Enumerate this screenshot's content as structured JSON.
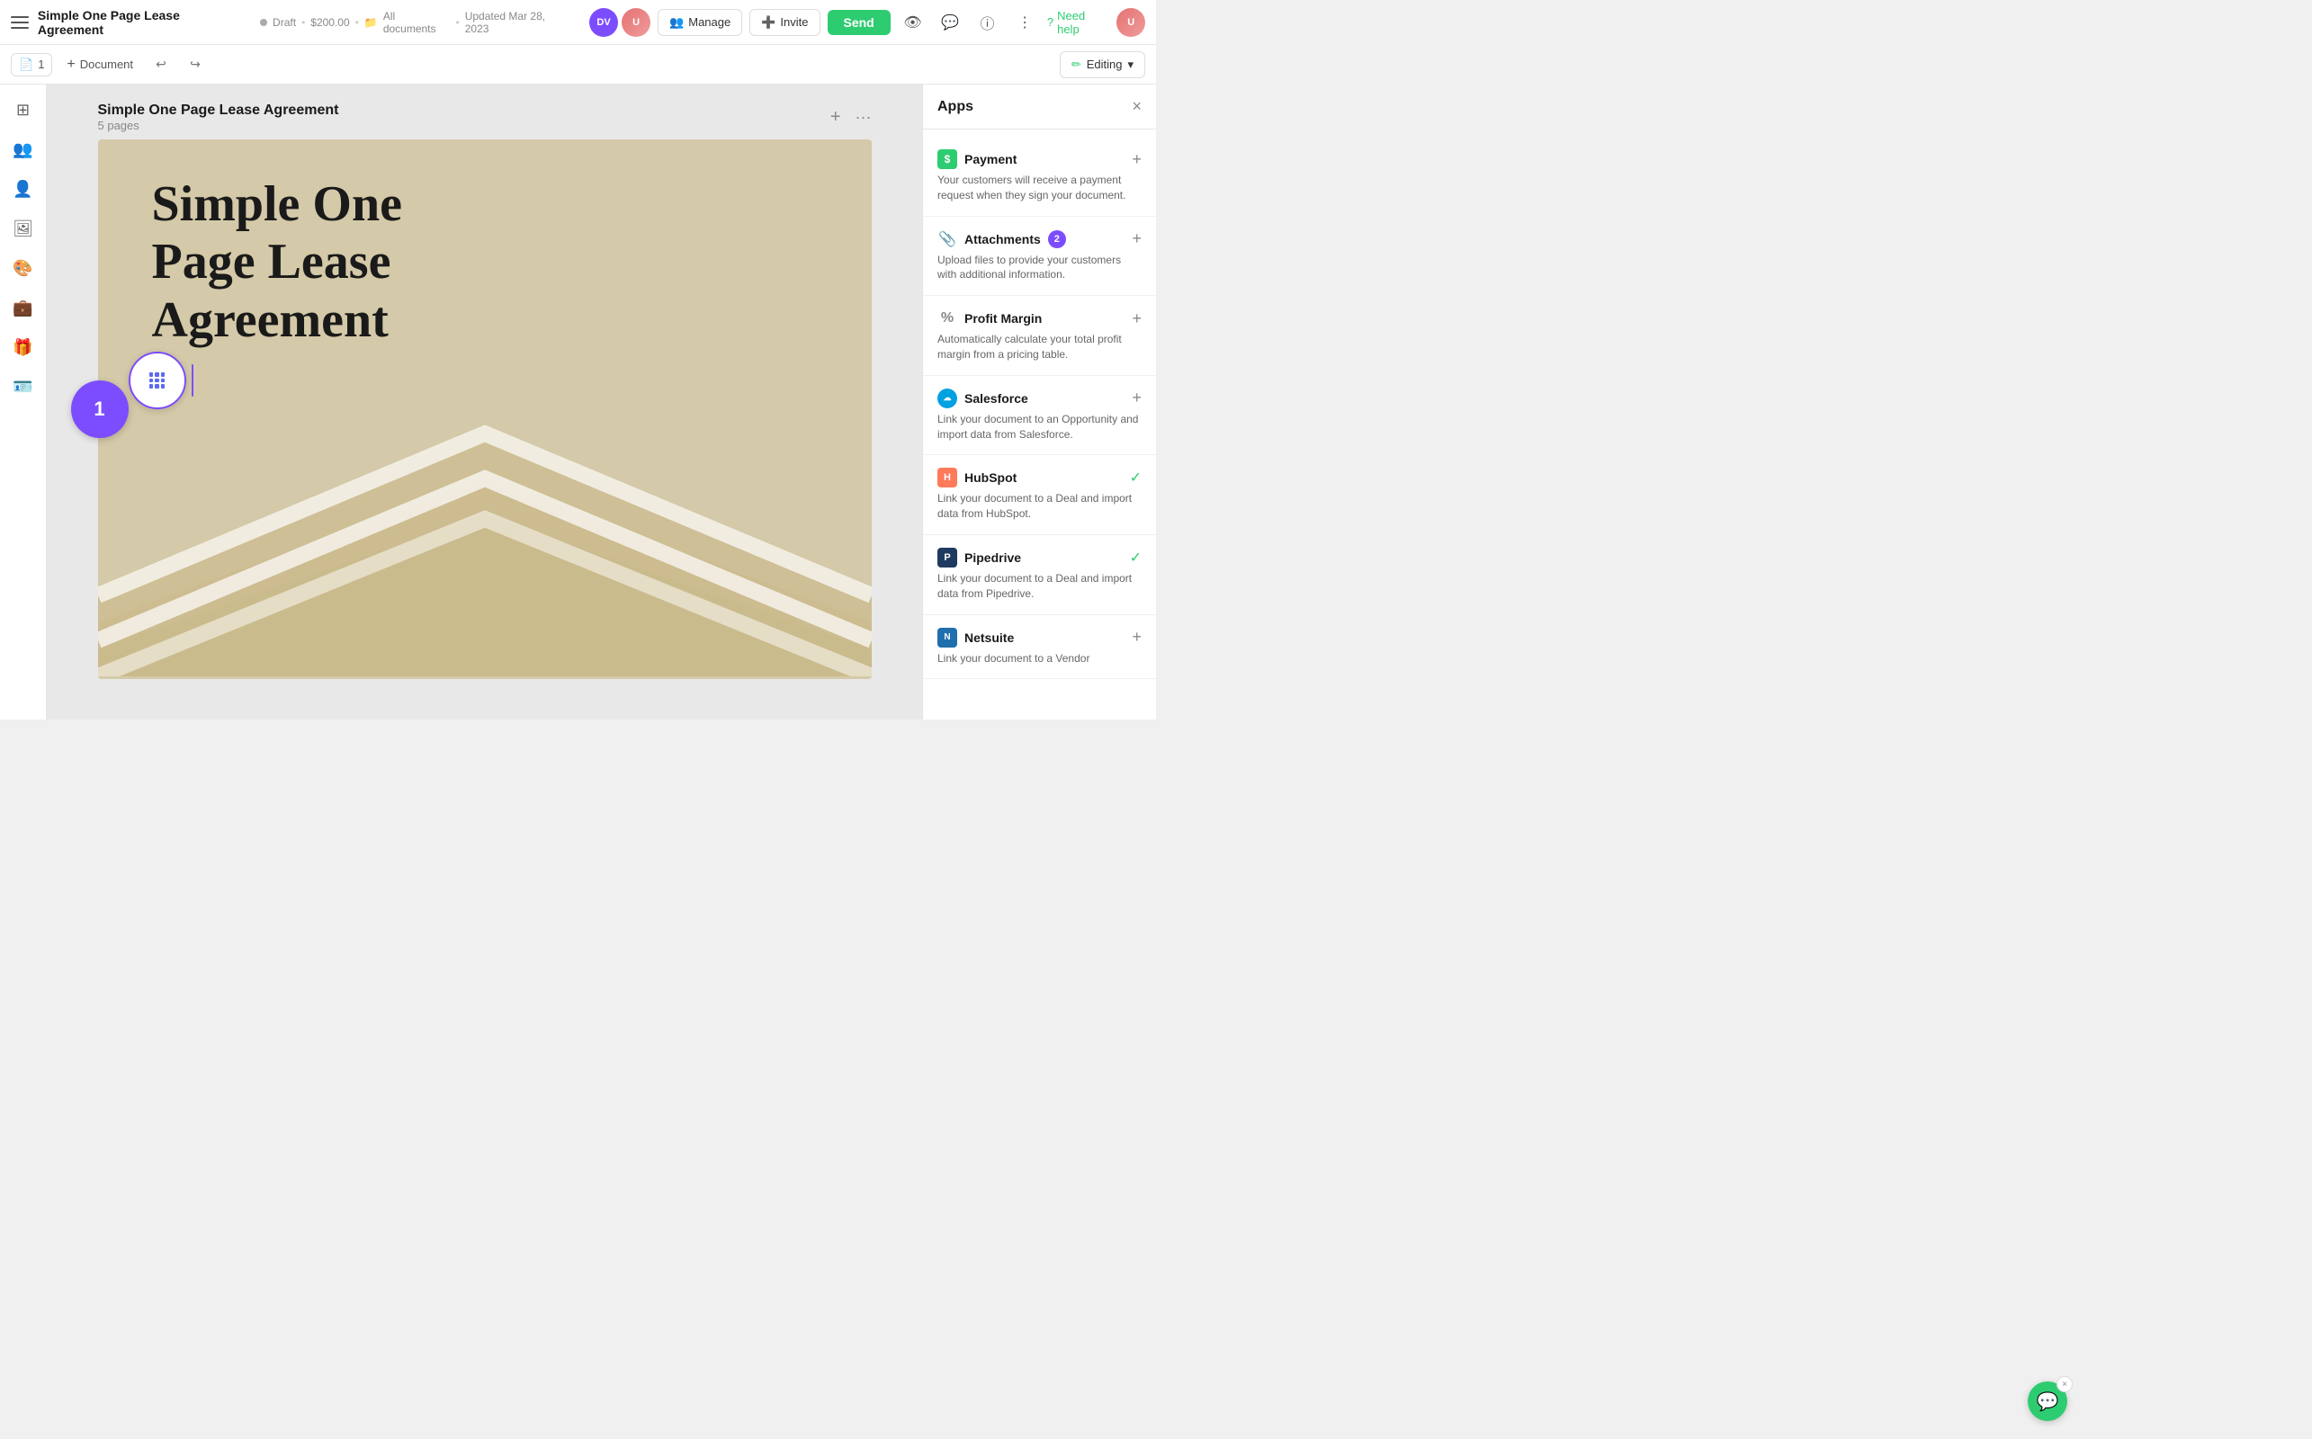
{
  "topnav": {
    "menu_label": "Menu",
    "doc_title": "Simple One Page Lease Agreement",
    "status": "Draft",
    "price": "$200.00",
    "folder": "All documents",
    "updated": "Updated Mar 28, 2023",
    "avatar_initials": "DV",
    "manage_label": "Manage",
    "invite_label": "Invite",
    "send_label": "Send",
    "help_label": "Need help"
  },
  "toolbar": {
    "page_count": "1",
    "add_document_label": "Document",
    "editing_label": "Editing"
  },
  "document": {
    "title": "Simple One Page Lease Agreement",
    "pages": "5 pages",
    "page_title": "Simple One\nPage Lease\nAgreement"
  },
  "apps_panel": {
    "title": "Apps",
    "close_label": "×",
    "apps": [
      {
        "id": "payment",
        "name": "Payment",
        "icon_type": "payment",
        "description": "Your customers will receive a payment request when they sign your document.",
        "action": "add"
      },
      {
        "id": "attachments",
        "name": "Attachments",
        "icon_type": "attach",
        "badge": "2",
        "description": "Upload files to provide your customers with additional information.",
        "action": "add"
      },
      {
        "id": "profit-margin",
        "name": "Profit Margin",
        "icon_type": "profit",
        "description": "Automatically calculate your total profit margin from a pricing table.",
        "action": "add"
      },
      {
        "id": "salesforce",
        "name": "Salesforce",
        "icon_type": "salesforce",
        "description": "Link your document to an Opportunity and import data from Salesforce.",
        "action": "add"
      },
      {
        "id": "hubspot",
        "name": "HubSpot",
        "icon_type": "hubspot",
        "description": "Link your document to a Deal and import data from HubSpot.",
        "action": "check"
      },
      {
        "id": "pipedrive",
        "name": "Pipedrive",
        "icon_type": "pipedrive",
        "description": "Link your document to a Deal and import data from Pipedrive.",
        "action": "check"
      },
      {
        "id": "netsuite",
        "name": "Netsuite",
        "icon_type": "netsuite",
        "description": "Link your document to a Vendor",
        "action": "add"
      }
    ]
  },
  "circles": {
    "circle1_label": "1",
    "circle2_label": "2"
  },
  "icons": {
    "hamburger": "☰",
    "undo": "↩",
    "redo": "↪",
    "chevron_down": "▾",
    "plus": "+",
    "more": "···",
    "close": "×",
    "eye": "👁",
    "chat_bubble": "💬",
    "info": "ⓘ",
    "more_vert": "⋮",
    "question": "?",
    "edit_pencil": "✏",
    "folder": "📁",
    "users": "👥",
    "user": "👤",
    "image": "🖼",
    "palette": "🎨",
    "briefcase": "💼",
    "gift": "🎁",
    "id_card": "🪪",
    "attach_clip": "📎",
    "percent": "%",
    "check": "✓",
    "grid": "⊞"
  }
}
